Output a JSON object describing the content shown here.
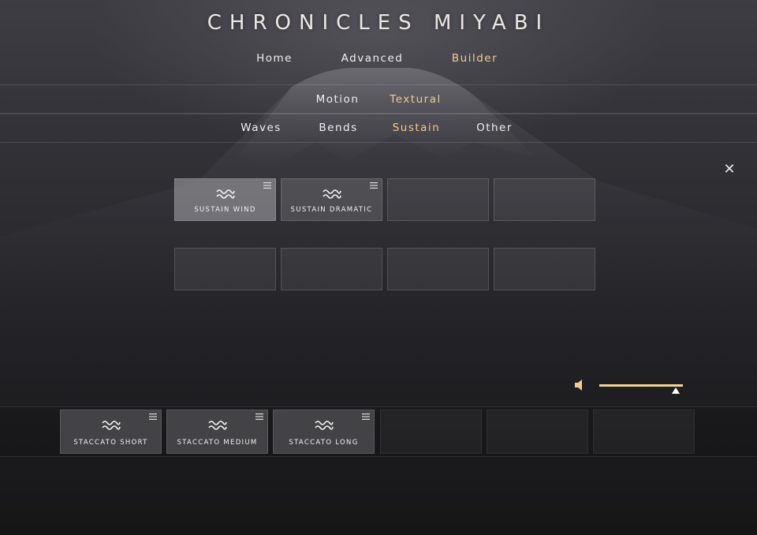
{
  "app": {
    "title": "CHRONICLES MIYABI"
  },
  "nav": {
    "main": [
      {
        "label": "Home",
        "active": false
      },
      {
        "label": "Advanced",
        "active": false
      },
      {
        "label": "Builder",
        "active": true
      }
    ],
    "sub": [
      {
        "label": "Motion",
        "active": false
      },
      {
        "label": "Textural",
        "active": true
      }
    ],
    "categories": [
      {
        "label": "Waves",
        "active": false
      },
      {
        "label": "Bends",
        "active": false
      },
      {
        "label": "Sustain",
        "active": true
      },
      {
        "label": "Other",
        "active": false
      }
    ]
  },
  "close": {
    "symbol": "✕"
  },
  "slots": [
    {
      "label": "SUSTAIN WIND",
      "icon": "wave-icon",
      "selected": true
    },
    {
      "label": "SUSTAIN DRAMATIC",
      "icon": "wave-icon",
      "selected": false
    },
    {
      "label": "",
      "icon": ""
    },
    {
      "label": "",
      "icon": ""
    },
    {
      "label": "",
      "icon": ""
    },
    {
      "label": "",
      "icon": ""
    },
    {
      "label": "",
      "icon": ""
    },
    {
      "label": "",
      "icon": ""
    }
  ],
  "dock": [
    {
      "label": "STACCATO SHORT",
      "icon": "wave-icon"
    },
    {
      "label": "STACCATO MEDIUM",
      "icon": "wave-icon"
    },
    {
      "label": "STACCATO LONG",
      "icon": "wave-icon"
    },
    {
      "label": "",
      "icon": ""
    },
    {
      "label": "",
      "icon": ""
    },
    {
      "label": "",
      "icon": ""
    }
  ],
  "volume": {
    "icon": "speaker-icon",
    "level": 0.9
  },
  "colors": {
    "accent": "#f2cc8f",
    "slider": "#f4d29a"
  }
}
